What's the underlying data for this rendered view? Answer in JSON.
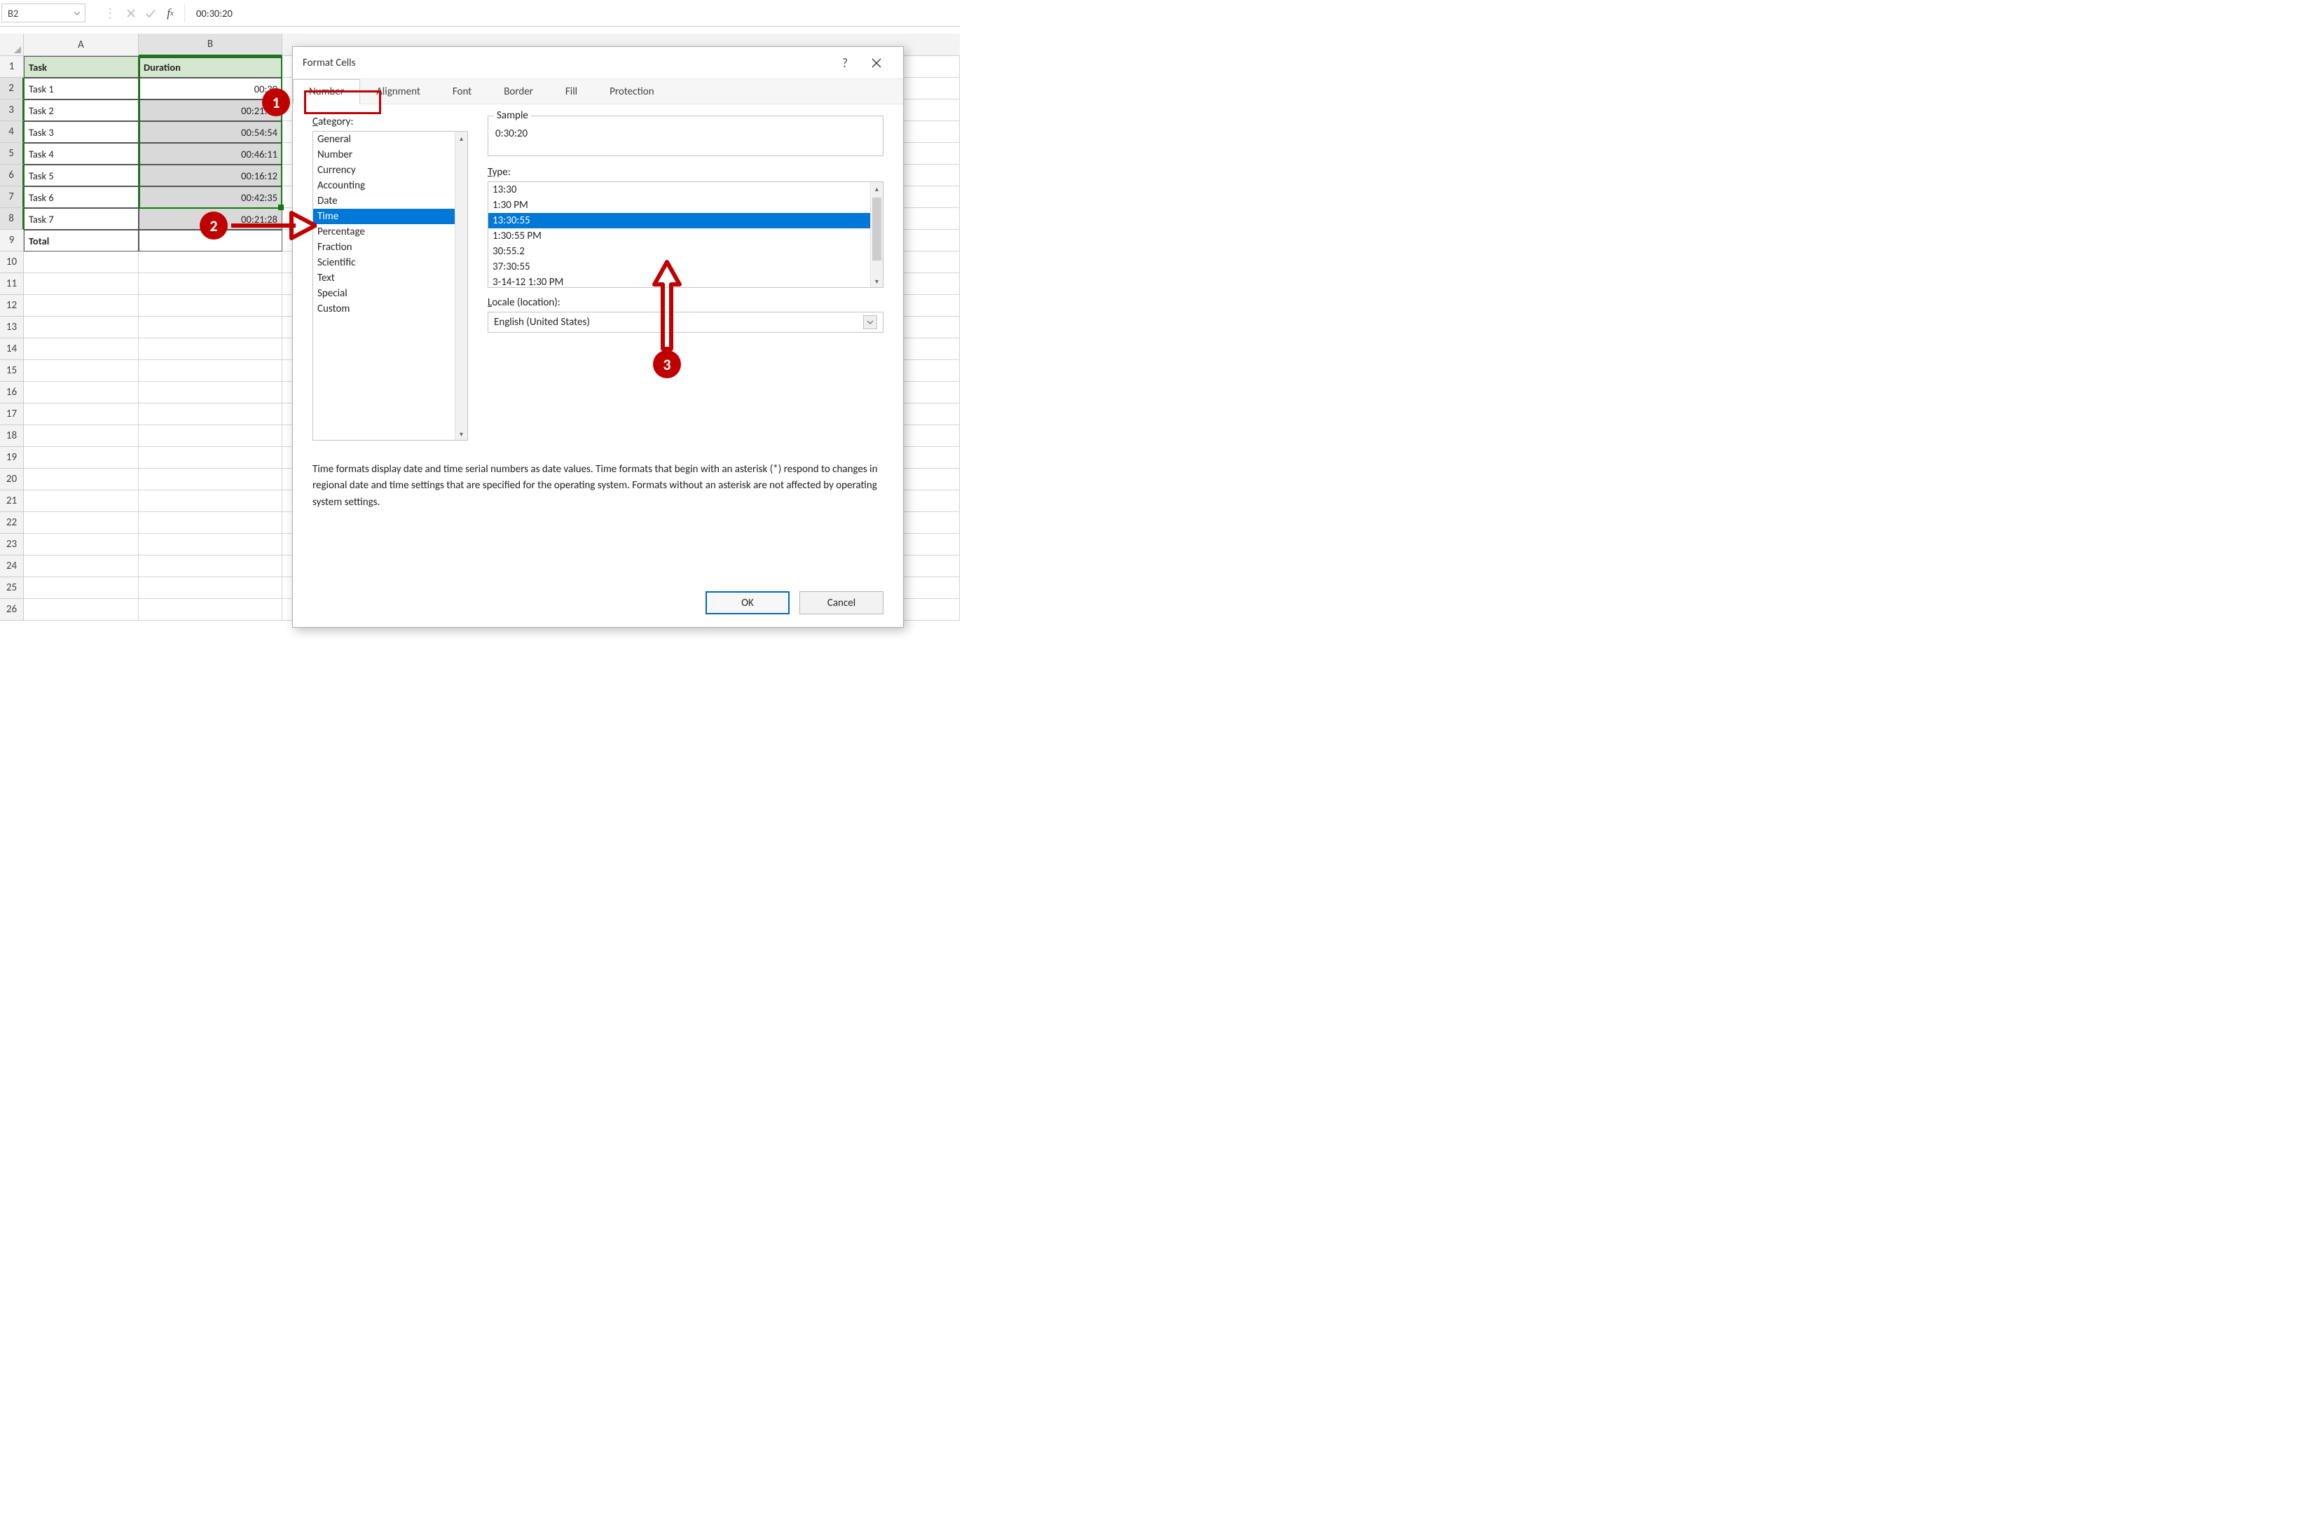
{
  "formulaBar": {
    "cellRef": "B2",
    "formula": "00:30:20"
  },
  "columns": [
    "A",
    "B"
  ],
  "rowNumbers": [
    1,
    2,
    3,
    4,
    5,
    6,
    7,
    8,
    9,
    10,
    11,
    12,
    13,
    14,
    15,
    16,
    17,
    18,
    19,
    20,
    21,
    22,
    23,
    24,
    25,
    26
  ],
  "sheet": {
    "headers": {
      "A": "Task",
      "B": "Duration"
    },
    "rows": [
      {
        "A": "Task 1",
        "B": "00:30"
      },
      {
        "A": "Task 2",
        "B": "00:21:13"
      },
      {
        "A": "Task 3",
        "B": "00:54:54"
      },
      {
        "A": "Task 4",
        "B": "00:46:11"
      },
      {
        "A": "Task 5",
        "B": "00:16:12"
      },
      {
        "A": "Task 6",
        "B": "00:42:35"
      },
      {
        "A": "Task 7",
        "B": "00:21:28"
      }
    ],
    "total": "Total"
  },
  "dialog": {
    "title": "Format Cells",
    "help": "?",
    "tabs": [
      "Number",
      "Alignment",
      "Font",
      "Border",
      "Fill",
      "Protection"
    ],
    "activeTab": "Number",
    "categoryLabel": "Category:",
    "categoryUnderline": "C",
    "categories": [
      "General",
      "Number",
      "Currency",
      "Accounting",
      "Date",
      "Time",
      "Percentage",
      "Fraction",
      "Scientific",
      "Text",
      "Special",
      "Custom"
    ],
    "categorySelected": "Time",
    "sampleLabel": "Sample",
    "sampleValue": "0:30:20",
    "typeLabel": "Type:",
    "typeUnderline": "T",
    "types": [
      "13:30",
      "1:30 PM",
      "13:30:55",
      "1:30:55 PM",
      "30:55.2",
      "37:30:55",
      "3-14-12 1:30 PM"
    ],
    "typeSelected": "13:30:55",
    "localeLabel": "Locale (location):",
    "localeUnderline": "L",
    "localeValue": "English (United States)",
    "description": "Time formats display date and time serial numbers as date values.  Time formats that begin with an asterisk (*) respond to changes in regional date and time settings that are specified for the operating system. Formats without an asterisk are not affected by operating system settings.",
    "okLabel": "OK",
    "cancelLabel": "Cancel"
  },
  "callouts": {
    "c1": "1",
    "c2": "2",
    "c3": "3"
  }
}
